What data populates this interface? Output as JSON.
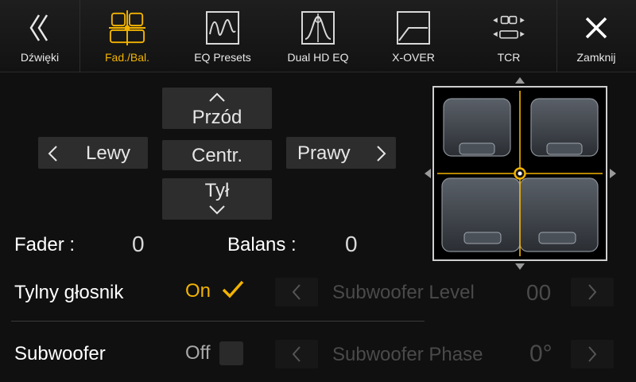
{
  "topbar": {
    "back_label": "Dźwięki",
    "tabs": [
      {
        "label": "Fad./Bal.",
        "icon": "fader-balance-icon",
        "active": true
      },
      {
        "label": "EQ Presets",
        "icon": "eq-presets-icon"
      },
      {
        "label": "Dual HD EQ",
        "icon": "dual-hd-eq-icon"
      },
      {
        "label": "X-OVER",
        "icon": "crossover-icon"
      },
      {
        "label": "TCR",
        "icon": "time-correction-icon"
      }
    ],
    "close_label": "Zamknij"
  },
  "pad": {
    "front_label": "Przód",
    "left_label": "Lewy",
    "center_label": "Centr.",
    "right_label": "Prawy",
    "rear_label": "Tył"
  },
  "status": {
    "fader_label": "Fader :",
    "fader_value": "0",
    "balance_label": "Balans :",
    "balance_value": "0"
  },
  "rear_speaker": {
    "label": "Tylny głosnik",
    "state": "On",
    "checked": true,
    "level_label": "Subwoofer Level",
    "level_value": "00"
  },
  "subwoofer": {
    "label": "Subwoofer",
    "state": "Off",
    "checked": false,
    "phase_label": "Subwoofer Phase",
    "phase_value": "0°"
  },
  "colors": {
    "accent": "#f2b300",
    "background": "#101010",
    "pad": "#2d2d2d"
  }
}
